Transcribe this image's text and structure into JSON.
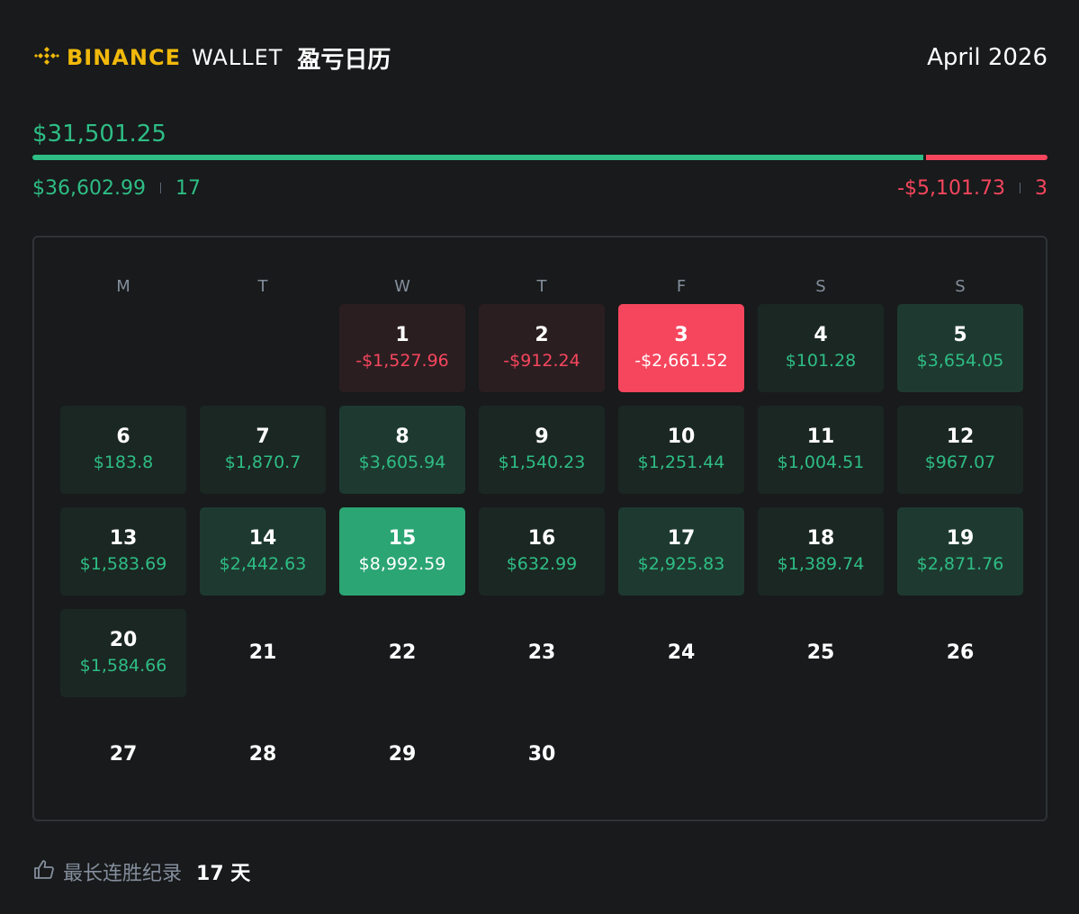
{
  "header": {
    "brand": "BINANCE",
    "wallet": "WALLET",
    "title": "盈亏日历",
    "month": "April 2026",
    "logo_icon": "binance-diamond-icon"
  },
  "summary": {
    "total": "$31,501.25",
    "gain_total": "$36,602.99",
    "gain_days": "17",
    "loss_total": "-$5,101.73",
    "loss_days": "3",
    "gain_ratio": 0.878
  },
  "colors": {
    "positive": "#2ebd85",
    "negative": "#f6465d",
    "brand": "#f0b90b",
    "background": "#181a1b"
  },
  "calendar": {
    "weekdays": [
      "M",
      "T",
      "W",
      "T",
      "F",
      "S",
      "S"
    ],
    "leading_blanks": 2,
    "days": [
      {
        "day": "1",
        "amount": "-$1,527.96",
        "tone": "r1"
      },
      {
        "day": "2",
        "amount": "-$912.24",
        "tone": "r1"
      },
      {
        "day": "3",
        "amount": "-$2,661.52",
        "tone": "r3"
      },
      {
        "day": "4",
        "amount": "$101.28",
        "tone": "g1"
      },
      {
        "day": "5",
        "amount": "$3,654.05",
        "tone": "g2"
      },
      {
        "day": "6",
        "amount": "$183.8",
        "tone": "g1"
      },
      {
        "day": "7",
        "amount": "$1,870.7",
        "tone": "g1"
      },
      {
        "day": "8",
        "amount": "$3,605.94",
        "tone": "g2"
      },
      {
        "day": "9",
        "amount": "$1,540.23",
        "tone": "g1"
      },
      {
        "day": "10",
        "amount": "$1,251.44",
        "tone": "g1"
      },
      {
        "day": "11",
        "amount": "$1,004.51",
        "tone": "g1"
      },
      {
        "day": "12",
        "amount": "$967.07",
        "tone": "g1"
      },
      {
        "day": "13",
        "amount": "$1,583.69",
        "tone": "g1"
      },
      {
        "day": "14",
        "amount": "$2,442.63",
        "tone": "g2"
      },
      {
        "day": "15",
        "amount": "$8,992.59",
        "tone": "g3"
      },
      {
        "day": "16",
        "amount": "$632.99",
        "tone": "g1"
      },
      {
        "day": "17",
        "amount": "$2,925.83",
        "tone": "g2"
      },
      {
        "day": "18",
        "amount": "$1,389.74",
        "tone": "g1"
      },
      {
        "day": "19",
        "amount": "$2,871.76",
        "tone": "g2"
      },
      {
        "day": "20",
        "amount": "$1,584.66",
        "tone": "g1"
      },
      {
        "day": "21",
        "amount": "",
        "tone": "empty"
      },
      {
        "day": "22",
        "amount": "",
        "tone": "empty"
      },
      {
        "day": "23",
        "amount": "",
        "tone": "empty"
      },
      {
        "day": "24",
        "amount": "",
        "tone": "empty"
      },
      {
        "day": "25",
        "amount": "",
        "tone": "empty"
      },
      {
        "day": "26",
        "amount": "",
        "tone": "empty"
      },
      {
        "day": "27",
        "amount": "",
        "tone": "empty"
      },
      {
        "day": "28",
        "amount": "",
        "tone": "empty"
      },
      {
        "day": "29",
        "amount": "",
        "tone": "empty"
      },
      {
        "day": "30",
        "amount": "",
        "tone": "empty"
      }
    ]
  },
  "footer": {
    "icon": "thumbs-up-icon",
    "label": "最长连胜纪录",
    "value": "17 天"
  }
}
